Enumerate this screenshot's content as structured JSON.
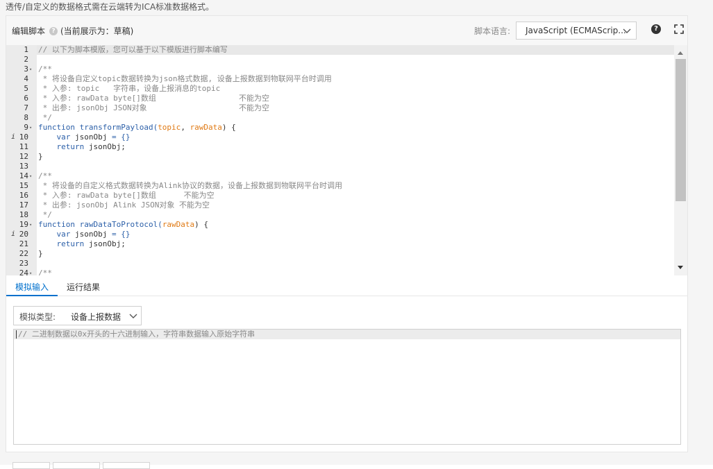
{
  "notice": "透传/自定义的数据格式需在云端转为ICA标准数据格式。",
  "header": {
    "title": "编辑脚本",
    "help_glyph": "?",
    "status": "(当前展示为：草稿)",
    "language_label": "脚本语言:",
    "language_value": "JavaScript (ECMAScrip...",
    "question_glyph": "?"
  },
  "editor": {
    "lines": [
      {
        "n": "1",
        "fold": false,
        "info": false,
        "parts": [
          {
            "t": "c",
            "s": "// 以下为脚本模版，您可以基于以下模版进行脚本编写"
          }
        ]
      },
      {
        "n": "2",
        "fold": false,
        "info": false,
        "parts": []
      },
      {
        "n": "3",
        "fold": true,
        "info": false,
        "parts": [
          {
            "t": "c",
            "s": "/**"
          }
        ]
      },
      {
        "n": "4",
        "fold": false,
        "info": false,
        "parts": [
          {
            "t": "c",
            "s": " * 将设备自定义topic数据转换为json格式数据, 设备上报数据到物联网平台时调用"
          }
        ]
      },
      {
        "n": "5",
        "fold": false,
        "info": false,
        "parts": [
          {
            "t": "c",
            "s": " * 入参: topic   字符串，设备上报消息的topic"
          }
        ]
      },
      {
        "n": "6",
        "fold": false,
        "info": false,
        "parts": [
          {
            "t": "c",
            "s": " * 入参: rawData byte[]数组                  不能为空"
          }
        ]
      },
      {
        "n": "7",
        "fold": false,
        "info": false,
        "parts": [
          {
            "t": "c",
            "s": " * 出参: jsonObj JSON对象                    不能为空"
          }
        ]
      },
      {
        "n": "8",
        "fold": false,
        "info": false,
        "parts": [
          {
            "t": "c",
            "s": " */"
          }
        ]
      },
      {
        "n": "9",
        "fold": true,
        "info": false,
        "parts": [
          {
            "t": "k",
            "s": "function transformPayload("
          },
          {
            "t": "p",
            "s": "topic"
          },
          {
            "t": "x",
            "s": ", "
          },
          {
            "t": "p",
            "s": "rawData"
          },
          {
            "t": "x",
            "s": ") {"
          }
        ]
      },
      {
        "n": "10",
        "fold": false,
        "info": true,
        "parts": [
          {
            "t": "x",
            "s": "    "
          },
          {
            "t": "k",
            "s": "var"
          },
          {
            "t": "x",
            "s": " jsonObj "
          },
          {
            "t": "k",
            "s": "= {}"
          }
        ]
      },
      {
        "n": "11",
        "fold": false,
        "info": false,
        "parts": [
          {
            "t": "x",
            "s": "    "
          },
          {
            "t": "k",
            "s": "return"
          },
          {
            "t": "x",
            "s": " jsonObj;"
          }
        ]
      },
      {
        "n": "12",
        "fold": false,
        "info": false,
        "parts": [
          {
            "t": "x",
            "s": "}"
          }
        ]
      },
      {
        "n": "13",
        "fold": false,
        "info": false,
        "parts": []
      },
      {
        "n": "14",
        "fold": true,
        "info": false,
        "parts": [
          {
            "t": "c",
            "s": "/**"
          }
        ]
      },
      {
        "n": "15",
        "fold": false,
        "info": false,
        "parts": [
          {
            "t": "c",
            "s": " * 将设备的自定义格式数据转换为Alink协议的数据，设备上报数据到物联网平台时调用"
          }
        ]
      },
      {
        "n": "16",
        "fold": false,
        "info": false,
        "parts": [
          {
            "t": "c",
            "s": " * 入参: rawData byte[]数组      不能为空"
          }
        ]
      },
      {
        "n": "17",
        "fold": false,
        "info": false,
        "parts": [
          {
            "t": "c",
            "s": " * 出参: jsonObj Alink JSON对象 不能为空"
          }
        ]
      },
      {
        "n": "18",
        "fold": false,
        "info": false,
        "parts": [
          {
            "t": "c",
            "s": " */"
          }
        ]
      },
      {
        "n": "19",
        "fold": true,
        "info": false,
        "parts": [
          {
            "t": "k",
            "s": "function rawDataToProtocol("
          },
          {
            "t": "p",
            "s": "rawData"
          },
          {
            "t": "x",
            "s": ") {"
          }
        ]
      },
      {
        "n": "20",
        "fold": false,
        "info": true,
        "parts": [
          {
            "t": "x",
            "s": "    "
          },
          {
            "t": "k",
            "s": "var"
          },
          {
            "t": "x",
            "s": " jsonObj "
          },
          {
            "t": "k",
            "s": "= {}"
          }
        ]
      },
      {
        "n": "21",
        "fold": false,
        "info": false,
        "parts": [
          {
            "t": "x",
            "s": "    "
          },
          {
            "t": "k",
            "s": "return"
          },
          {
            "t": "x",
            "s": " jsonObj;"
          }
        ]
      },
      {
        "n": "22",
        "fold": false,
        "info": false,
        "parts": [
          {
            "t": "x",
            "s": "}"
          }
        ]
      },
      {
        "n": "23",
        "fold": false,
        "info": false,
        "parts": []
      },
      {
        "n": "24",
        "fold": true,
        "info": false,
        "parts": [
          {
            "t": "c",
            "s": "/**"
          }
        ]
      }
    ],
    "info_glyph": "i",
    "fold_glyph": "▾"
  },
  "tabs": {
    "simulate_input": "模拟输入",
    "run_result": "运行结果"
  },
  "simulation": {
    "type_label": "模拟类型:",
    "type_value": "设备上报数据",
    "placeholder": "// 二进制数据以0x开头的十六进制输入，字符串数据输入原始字符串"
  },
  "colors": {
    "accent": "#0070cc",
    "keyword": "#2b5fa8",
    "param": "#e07a14",
    "comment": "#888888"
  }
}
